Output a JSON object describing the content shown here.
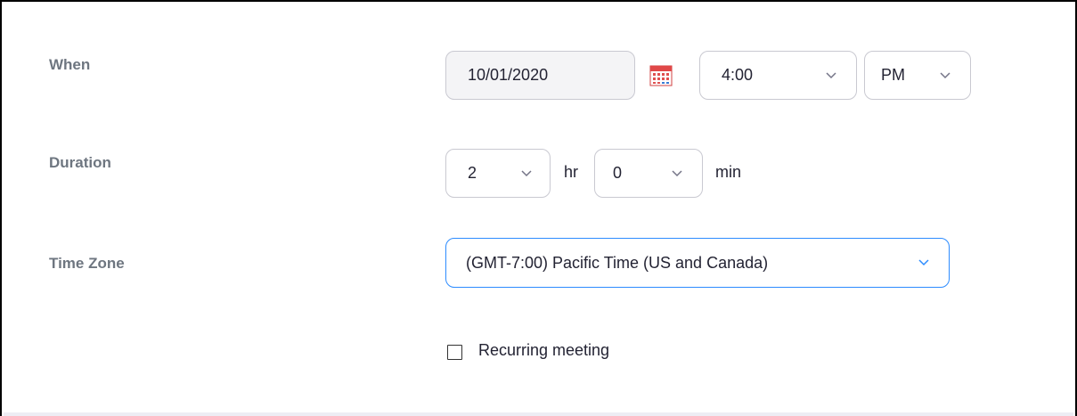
{
  "when": {
    "label": "When",
    "date_value": "10/01/2020",
    "calendar_icon": "calendar-icon",
    "time_value": "4:00",
    "ampm_value": "PM"
  },
  "duration": {
    "label": "Duration",
    "hours_value": "2",
    "hours_unit": "hr",
    "minutes_value": "0",
    "minutes_unit": "min"
  },
  "timezone": {
    "label": "Time Zone",
    "value": "(GMT-7:00) Pacific Time (US and Canada)",
    "focus_color": "#2d8cff"
  },
  "recurring": {
    "label": "Recurring meeting",
    "checked": false
  },
  "icons": {
    "chevron": "chevron-down-icon",
    "calendar": "calendar-icon"
  }
}
